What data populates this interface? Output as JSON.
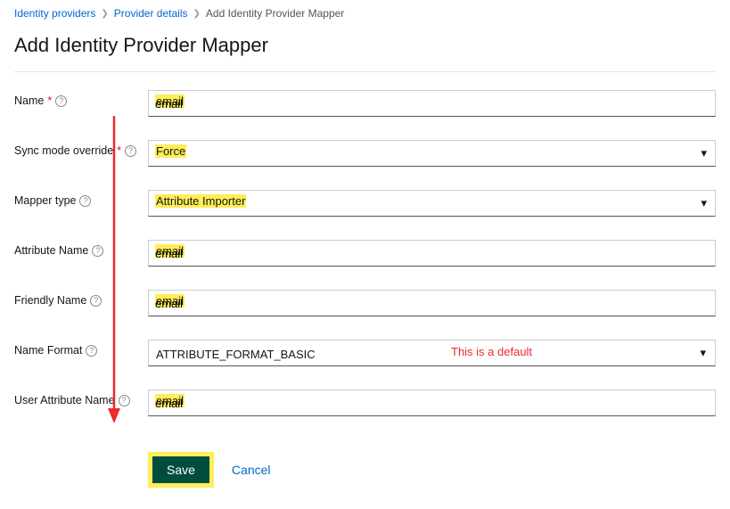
{
  "breadcrumb": {
    "identity_providers": "Identity providers",
    "provider_details": "Provider details",
    "current": "Add Identity Provider Mapper"
  },
  "page_title": "Add Identity Provider Mapper",
  "labels": {
    "name": "Name",
    "sync_mode": "Sync mode override",
    "mapper_type": "Mapper type",
    "attribute_name": "Attribute Name",
    "friendly_name": "Friendly Name",
    "name_format": "Name Format",
    "user_attribute_name": "User Attribute Name"
  },
  "values": {
    "name": "email",
    "sync_mode": "Force",
    "mapper_type": "Attribute Importer",
    "attribute_name": "email",
    "friendly_name": "email",
    "name_format": "ATTRIBUTE_FORMAT_BASIC",
    "user_attribute_name": "email"
  },
  "annotation": {
    "name_format_note": "This is a default"
  },
  "actions": {
    "save": "Save",
    "cancel": "Cancel"
  }
}
